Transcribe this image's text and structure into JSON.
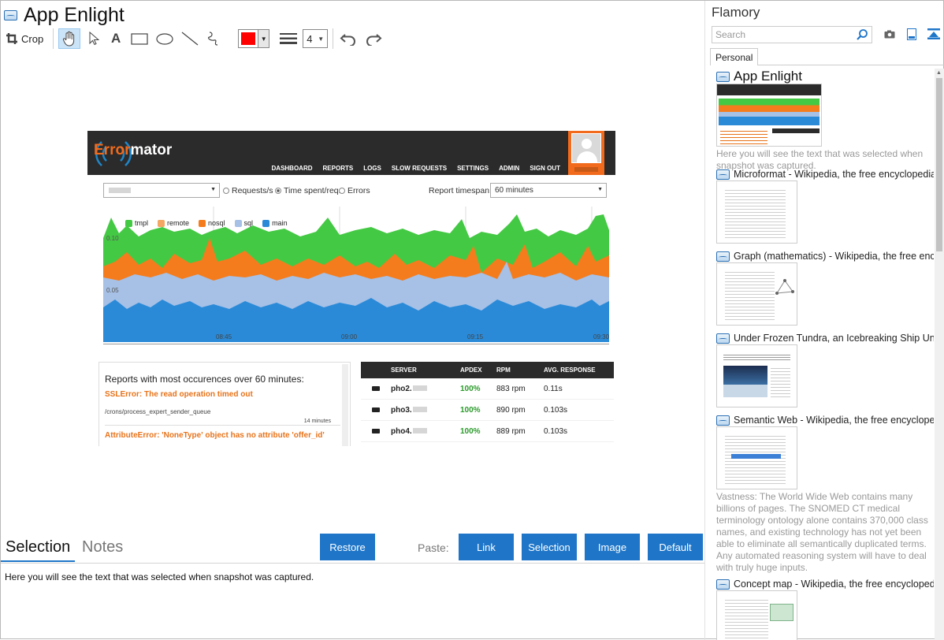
{
  "window": {
    "title": "App Enlight",
    "side_title": "Flamory"
  },
  "toolbar": {
    "crop_label": "Crop",
    "stroke_width": "4",
    "color": "#ff0000"
  },
  "capture": {
    "logo_pre": "Error",
    "logo_post": "mator",
    "nav": [
      "DASHBOARD",
      "REPORTS",
      "LOGS",
      "SLOW REQUESTS",
      "SETTINGS",
      "ADMIN",
      "SIGN OUT"
    ],
    "radios": [
      "Requests/s",
      "Time spent/req.",
      "Errors"
    ],
    "timespan_label": "Report timespan:",
    "timespan_value": "60 minutes",
    "legend": [
      {
        "name": "tmpl",
        "color": "#44c944"
      },
      {
        "name": "remote",
        "color": "#f3a763"
      },
      {
        "name": "nosql",
        "color": "#f57c1c"
      },
      {
        "name": "sql",
        "color": "#a6c0e6"
      },
      {
        "name": "main",
        "color": "#2a8ad8"
      }
    ],
    "y_ticks": [
      "0.10",
      "0.05"
    ],
    "x_ticks": [
      "08:45",
      "09:00",
      "09:15",
      "09:30"
    ],
    "reports_title": "Reports with most occurences over 60 minutes:",
    "error_1": "SSLError: The read operation timed out",
    "error_path": "/crons/process_expert_sender_queue",
    "error_count": "14 minutes",
    "error_2": "AttributeError: 'NoneType' object has no attribute 'offer_id'",
    "servers_head": [
      "SERVER",
      "APDEX",
      "RPM",
      "AVG. RESPONSE"
    ],
    "servers": [
      {
        "name": "pho2.",
        "apdex": "100%",
        "rpm": "883 rpm",
        "avg": "0.11s"
      },
      {
        "name": "pho3.",
        "apdex": "100%",
        "rpm": "890 rpm",
        "avg": "0.103s"
      },
      {
        "name": "pho4.",
        "apdex": "100%",
        "rpm": "889 rpm",
        "avg": "0.103s"
      }
    ]
  },
  "bottom": {
    "tab_selection": "Selection",
    "tab_notes": "Notes",
    "restore": "Restore",
    "paste_label": "Paste:",
    "paste_link": "Link",
    "paste_selection": "Selection",
    "paste_image": "Image",
    "paste_default": "Default",
    "selected_text": "Here you will see the text that was selected when snapshot was captured."
  },
  "flamory": {
    "search_placeholder": "Search",
    "tab_personal": "Personal",
    "items": [
      {
        "title": "App Enlight",
        "desc": "Here you will see the text that was selected when snapshot was captured."
      },
      {
        "title": "Microformat - Wikipedia, the free encyclopedia",
        "desc": ""
      },
      {
        "title": "Graph (mathematics) - Wikipedia, the free ency",
        "desc": ""
      },
      {
        "title": "Under Frozen Tundra, an Icebreaking Ship Unco",
        "desc": ""
      },
      {
        "title": "Semantic Web - Wikipedia, the free encycloped",
        "desc": "Vastness: The World Wide Web contains many billions of pages. The SNOMED CT medical terminology ontology alone contains 370,000 class names, and existing technology has not yet been able to eliminate all semantically duplicated terms. Any automated reasoning system will have to deal with truly huge inputs."
      },
      {
        "title": "Concept map - Wikipedia, the free encyclopedi",
        "desc": ""
      }
    ]
  }
}
